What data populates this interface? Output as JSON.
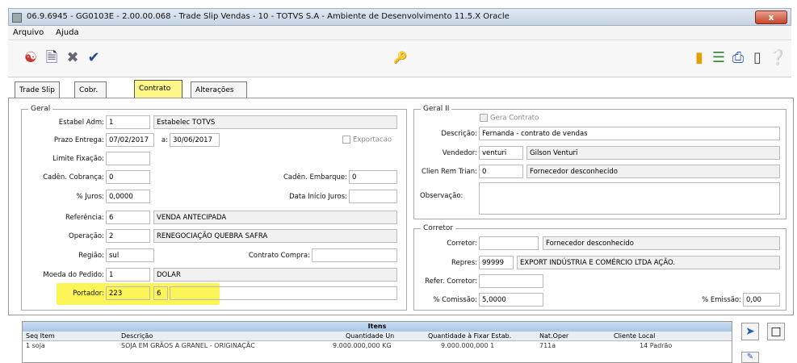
{
  "window": {
    "title": "06.9.6945 - GG0103E - 2.00.00.068 - Trade Slip Vendas - 10 - TOTVS S.A - Ambiente de Desenvolvimento 11.5.X Oracle",
    "close": "x"
  },
  "menu": [
    "Arquivo",
    "Ajuda"
  ],
  "toolbar": {
    "icons_left": [
      "users-icon",
      "document-icon",
      "tools-icon",
      "check-icon"
    ],
    "icons_mid": [
      "key-icon"
    ],
    "icons_right": [
      "book-icon",
      "tree-icon",
      "print-icon",
      "door-icon",
      "help-icon"
    ]
  },
  "tabs": [
    "Trade Slip",
    "Cobr.",
    "Contrato",
    "Alterações"
  ],
  "active_tab": "Contrato",
  "geral": {
    "legend": "Geral",
    "estab_label": "Estabel Adm:",
    "estab_code": "1",
    "estab_name": "Estabelec TOTVS",
    "prazo_label": "Prazo Entrega:",
    "prazo_from": "07/02/2017",
    "prazo_sep": "a:",
    "prazo_to": "30/06/2017",
    "exportacao": "Exportacao",
    "limite_label": "Limite Fixação:",
    "limite_value": "",
    "caden_cob_label": "Cadên. Cobrança:",
    "caden_cob_value": "0",
    "caden_emb_label": "Cadên. Embarque:",
    "caden_emb_value": "0",
    "juros_label": "% Juros:",
    "juros_value": "0,0000",
    "data_juros_label": "Data Início Juros:",
    "data_juros_value": "",
    "ref_label": "Referência:",
    "ref_code": "6",
    "ref_name": "VENDA ANTECIPADA",
    "op_label": "Operação:",
    "op_code": "2",
    "op_name": "RENEGOCIAÇÃO QUEBRA SAFRA",
    "regiao_label": "Região:",
    "regiao_value": "sul",
    "contrato_compra_label": "Contrato Compra:",
    "contrato_compra_value": "",
    "moeda_label": "Moeda do Pedido:",
    "moeda_code": "1",
    "moeda_name": "DOLAR",
    "portador_label": "Portador:",
    "portador_code": "223",
    "portador_mod": "6",
    "portador_name": ""
  },
  "geral2": {
    "legend": "Geral II",
    "gera_contrato": "Gera Contrato",
    "descricao_label": "Descrição:",
    "descricao_value": "Fernanda - contrato de vendas",
    "vendedor_label": "Vendedor:",
    "vendedor_code": "venturi",
    "vendedor_name": "Gilson Venturi",
    "clien_label": "Clien Rem Trian:",
    "clien_code": "0",
    "clien_name": "Fornecedor desconhecido",
    "obs_label": "Observação:",
    "obs_value": ""
  },
  "corretor": {
    "legend": "Corretor",
    "corretor_label": "Corretor:",
    "corretor_code": "",
    "corretor_name": "Fornecedor desconhecido",
    "repres_label": "Repres:",
    "repres_code": "99999",
    "repres_name": "EXPORT INDÚSTRIA E COMÉRCIO LTDA AÇÃO.",
    "refer_label": "Refer. Corretor:",
    "refer_value": "",
    "comissao_label": "% Comissão:",
    "comissao_value": "5,0000",
    "emissao_label": "% Emissão:",
    "emissao_value": "0,00"
  },
  "itens": {
    "caption": "Itens",
    "columns": [
      "Seq Item",
      "Descrição",
      "Quantidade Un",
      "Quantidade à Fixar Estab.",
      "Nat.Oper",
      "Cliente Local"
    ],
    "rows": [
      [
        "1 soja",
        "SOJA EM GRÃOS A GRANEL - ORIGINAÇÃC",
        "9.000.000,000 KG",
        "9.000.000,000 1",
        "711a",
        "14 Padrão"
      ]
    ]
  }
}
